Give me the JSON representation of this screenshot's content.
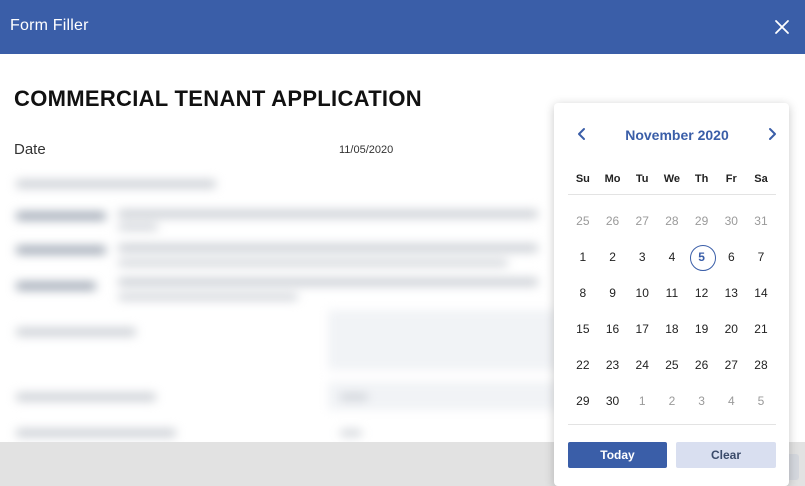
{
  "window": {
    "title": "Form Filler",
    "close_icon": "close-icon"
  },
  "form": {
    "title": "COMMERCIAL TENANT APPLICATION",
    "date_label": "Date",
    "date_value": "11/05/2020"
  },
  "calendar": {
    "month_label": "November 2020",
    "prev_icon": "chevron-left-icon",
    "next_icon": "chevron-right-icon",
    "weekdays": [
      "Su",
      "Mo",
      "Tu",
      "We",
      "Th",
      "Fr",
      "Sa"
    ],
    "days": [
      {
        "label": "25",
        "muted": true
      },
      {
        "label": "26",
        "muted": true
      },
      {
        "label": "27",
        "muted": true
      },
      {
        "label": "28",
        "muted": true
      },
      {
        "label": "29",
        "muted": true
      },
      {
        "label": "30",
        "muted": true
      },
      {
        "label": "31",
        "muted": true
      },
      {
        "label": "1"
      },
      {
        "label": "2"
      },
      {
        "label": "3"
      },
      {
        "label": "4"
      },
      {
        "label": "5",
        "selected": true
      },
      {
        "label": "6"
      },
      {
        "label": "7"
      },
      {
        "label": "8"
      },
      {
        "label": "9"
      },
      {
        "label": "10"
      },
      {
        "label": "11"
      },
      {
        "label": "12"
      },
      {
        "label": "13"
      },
      {
        "label": "14"
      },
      {
        "label": "15"
      },
      {
        "label": "16"
      },
      {
        "label": "17"
      },
      {
        "label": "18"
      },
      {
        "label": "19"
      },
      {
        "label": "20"
      },
      {
        "label": "21"
      },
      {
        "label": "22"
      },
      {
        "label": "23"
      },
      {
        "label": "24"
      },
      {
        "label": "25"
      },
      {
        "label": "26"
      },
      {
        "label": "27"
      },
      {
        "label": "28"
      },
      {
        "label": "29"
      },
      {
        "label": "30"
      },
      {
        "label": "1",
        "muted": true
      },
      {
        "label": "2",
        "muted": true
      },
      {
        "label": "3",
        "muted": true
      },
      {
        "label": "4",
        "muted": true
      },
      {
        "label": "5",
        "muted": true
      }
    ],
    "today_label": "Today",
    "clear_label": "Clear"
  },
  "colors": {
    "accent": "#3a5ea8",
    "clear_bg": "#d9dff0"
  }
}
